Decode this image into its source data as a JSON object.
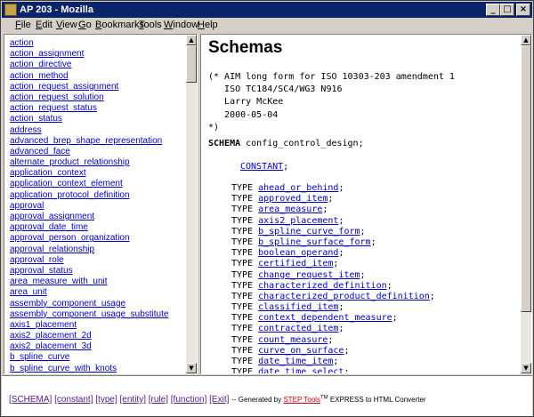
{
  "window": {
    "title": "AP 203 - Mozilla",
    "minimize_glyph": "_",
    "maximize_glyph": "□",
    "close_glyph": "×"
  },
  "menu": [
    "File",
    "Edit",
    "View",
    "Go",
    "Bookmarks",
    "Tools",
    "Window",
    "Help"
  ],
  "left_frame": {
    "links": [
      "action",
      "action_assignment",
      "action_directive",
      "action_method",
      "action_request_assignment",
      "action_request_solution",
      "action_request_status",
      "action_status",
      "address",
      "advanced_brep_shape_representation",
      "advanced_face",
      "alternate_product_relationship",
      "application_context",
      "application_context_element",
      "application_protocol_definition",
      "approval",
      "approval_assignment",
      "approval_date_time",
      "approval_person_organization",
      "approval_relationship",
      "approval_role",
      "approval_status",
      "area_measure_with_unit",
      "area_unit",
      "assembly_component_usage",
      "assembly_component_usage_substitute",
      "axis1_placement",
      "axis2_placement_2d",
      "axis2_placement_3d",
      "b_spline_curve",
      "b_spline_curve_with_knots"
    ]
  },
  "right_frame": {
    "heading": "Schemas",
    "comment_lines": [
      "(* AIM long form for ISO 10303-203 amendment 1",
      "   ISO TC184/SC4/WG3 N916",
      "   Larry McKee",
      "   2000-05-04",
      "*)"
    ],
    "schema_keyword": "SCHEMA",
    "schema_name": " config_control_design;",
    "constant_link": "CONSTANT",
    "constant_suffix": ";",
    "type_keyword": "TYPE",
    "types": [
      "ahead_or_behind",
      "approved_item",
      "area_measure",
      "axis2_placement",
      "b_spline_curve_form",
      "b_spline_surface_form",
      "boolean_operand",
      "certified_item",
      "change_request_item",
      "characterized_definition",
      "characterized_product_definition",
      "classified_item",
      "context_dependent_measure",
      "contracted_item",
      "count_measure",
      "curve_on_surface",
      "date_time_item",
      "date_time_select"
    ]
  },
  "footer": {
    "nav": [
      "[SCHEMA]",
      "[constant]",
      "[type]",
      "[entity]",
      "[rule]",
      "[function]",
      "[Exit]"
    ],
    "generated_prefix": "-- Generated by",
    "tool_name": "STEP Tools",
    "tm": "TM",
    "generated_suffix": "EXPRESS to HTML Converter"
  }
}
